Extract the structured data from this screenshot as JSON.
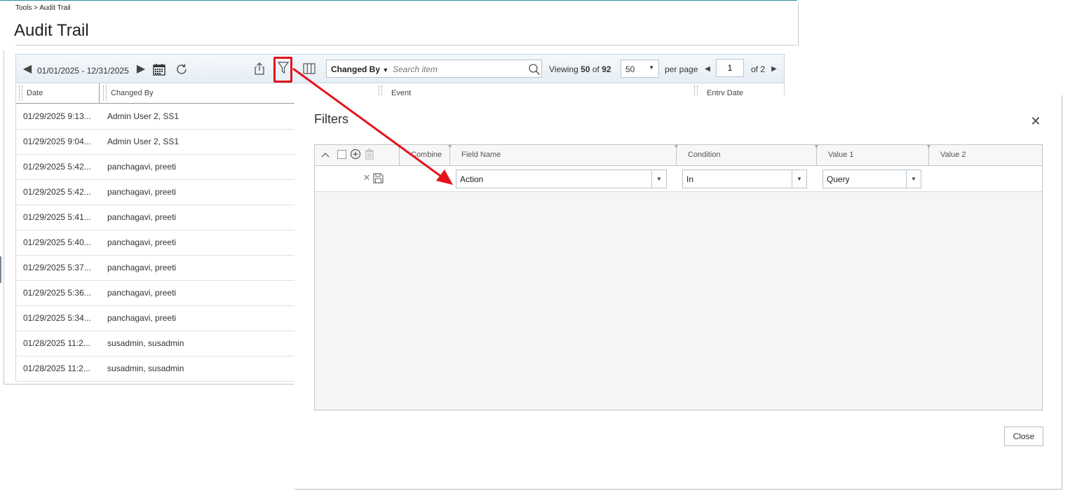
{
  "breadcrumb": "Tools > Audit Trail",
  "page_title": "Audit Trail",
  "toolbar": {
    "date_range": "01/01/2025 - 12/31/2025",
    "search_field": "Changed By",
    "search_placeholder": "Search item",
    "viewing_prefix": "Viewing",
    "viewing_count": "50",
    "viewing_of": "of",
    "viewing_total": "92",
    "page_size": "50",
    "per_page_label": "per page",
    "current_page": "1",
    "of_pages": "of 2"
  },
  "columns": {
    "date": "Date",
    "changed_by": "Changed By",
    "event": "Event",
    "entry_date": "Entry Date"
  },
  "rows": [
    {
      "date": "01/29/2025 9:13...",
      "user": "Admin User 2, SS1"
    },
    {
      "date": "01/29/2025 9:04...",
      "user": "Admin User 2, SS1"
    },
    {
      "date": "01/29/2025 5:42...",
      "user": "panchagavi, preeti"
    },
    {
      "date": "01/29/2025 5:42...",
      "user": "panchagavi, preeti"
    },
    {
      "date": "01/29/2025 5:41...",
      "user": "panchagavi, preeti"
    },
    {
      "date": "01/29/2025 5:40...",
      "user": "panchagavi, preeti"
    },
    {
      "date": "01/29/2025 5:37...",
      "user": "panchagavi, preeti"
    },
    {
      "date": "01/29/2025 5:36...",
      "user": "panchagavi, preeti"
    },
    {
      "date": "01/29/2025 5:34...",
      "user": "panchagavi, preeti"
    },
    {
      "date": "01/28/2025 11:2...",
      "user": "susadmin, susadmin"
    },
    {
      "date": "01/28/2025 11:2...",
      "user": "susadmin, susadmin"
    }
  ],
  "modal": {
    "title": "Filters",
    "headers": {
      "combine": "Combine",
      "field_name": "Field Name",
      "condition": "Condition",
      "value1": "Value 1",
      "value2": "Value 2"
    },
    "filter_row": {
      "field_name": "Action",
      "condition": "In",
      "value1": "Query"
    },
    "close_label": "Close"
  },
  "colors": {
    "highlight": "#e5141b",
    "accent": "#2a8fa6"
  }
}
